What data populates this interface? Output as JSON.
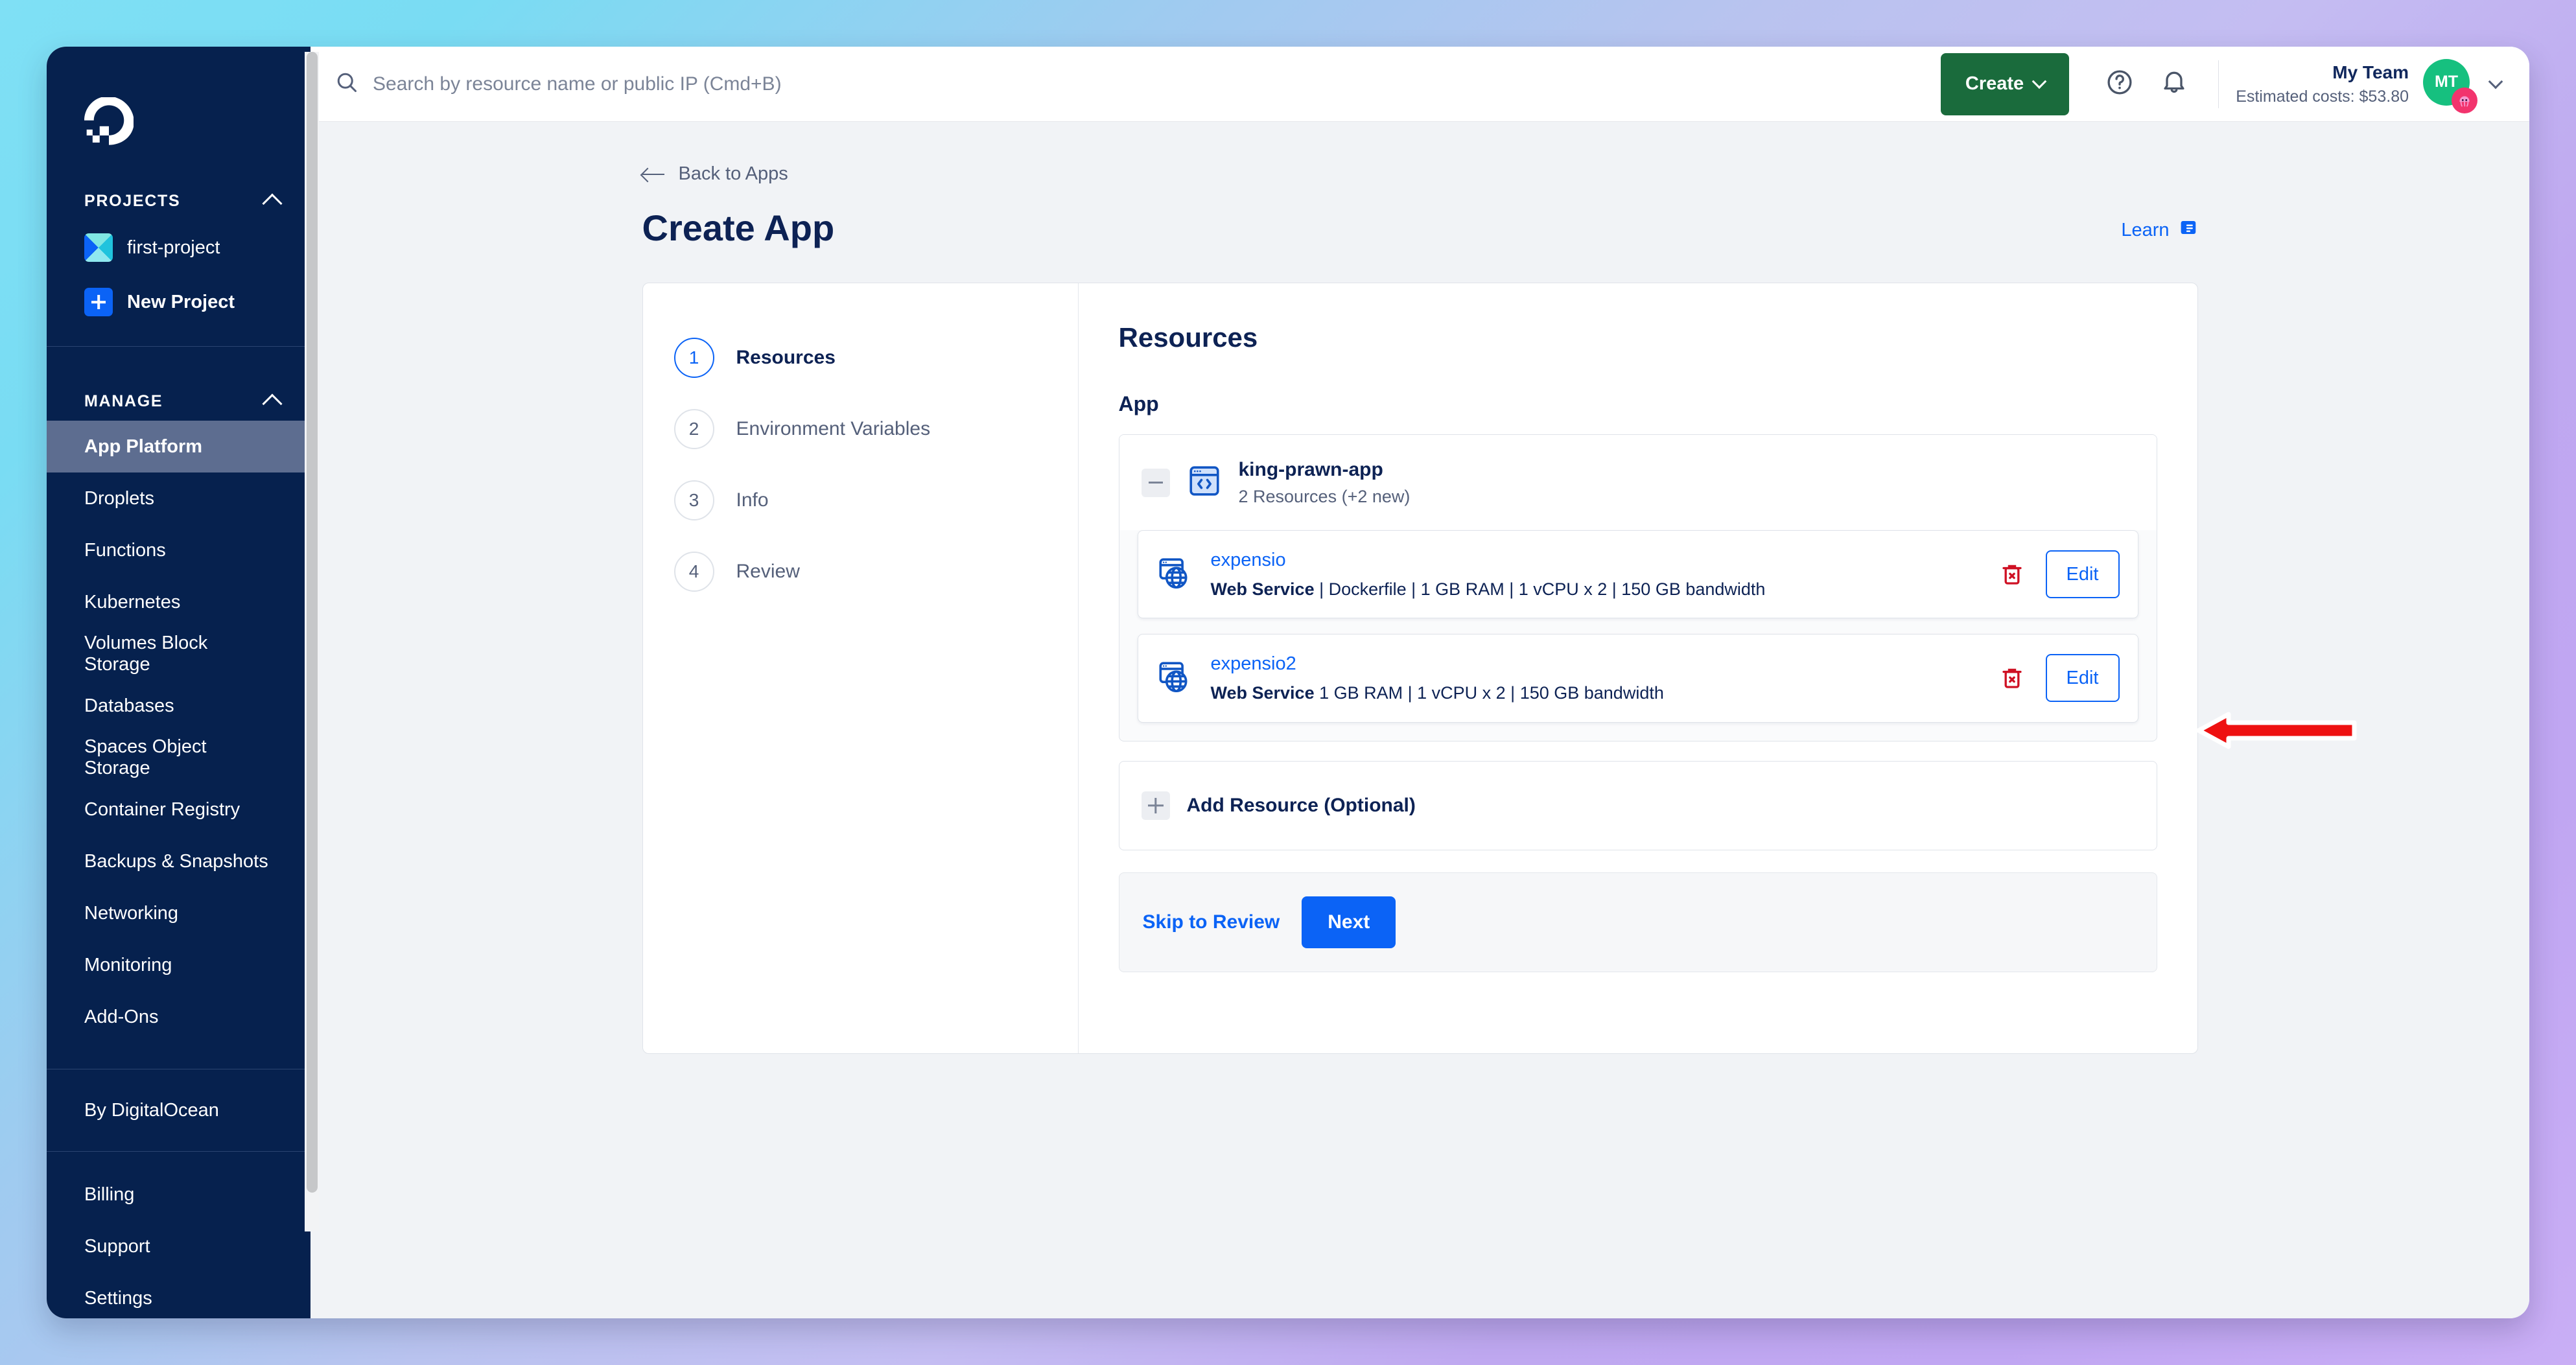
{
  "sidebar": {
    "logo_icon": "digitalocean-logo",
    "projects_section": {
      "label": "PROJECTS",
      "collapse_icon": "chevron-up-icon",
      "items": [
        {
          "label": "first-project",
          "icon": "project-swatch-icon"
        },
        {
          "label": "New Project",
          "icon": "plus-square-icon"
        }
      ]
    },
    "manage_section": {
      "label": "MANAGE",
      "collapse_icon": "chevron-up-icon",
      "items": [
        {
          "label": "App Platform",
          "active": true
        },
        {
          "label": "Droplets",
          "active": false
        },
        {
          "label": "Functions",
          "active": false
        },
        {
          "label": "Kubernetes",
          "active": false
        },
        {
          "label": "Volumes Block Storage",
          "active": false
        },
        {
          "label": "Databases",
          "active": false
        },
        {
          "label": "Spaces Object Storage",
          "active": false
        },
        {
          "label": "Container Registry",
          "active": false
        },
        {
          "label": "Backups & Snapshots",
          "active": false
        },
        {
          "label": "Networking",
          "active": false
        },
        {
          "label": "Monitoring",
          "active": false
        },
        {
          "label": "Add-Ons",
          "active": false
        }
      ]
    },
    "by_digitalocean": "By DigitalOcean",
    "account_items": [
      {
        "label": "Billing"
      },
      {
        "label": "Support"
      },
      {
        "label": "Settings"
      }
    ]
  },
  "topbar": {
    "search_placeholder": "Search by resource name or public IP (Cmd+B)",
    "search_value": "",
    "search_icon": "search-icon",
    "create_label": "Create",
    "create_caret_icon": "chevron-down-icon",
    "help_icon": "question-circle-icon",
    "notifications_icon": "bell-icon",
    "team_name": "My Team",
    "team_cost": "Estimated costs: $53.80",
    "avatar_initials": "MT",
    "avatar_badge_icon": "jellyfish-icon",
    "user_caret_icon": "chevron-down-icon"
  },
  "page": {
    "back_label": "Back to Apps",
    "back_icon": "arrow-left-icon",
    "title": "Create App",
    "learn_label": "Learn",
    "learn_icon": "document-icon"
  },
  "wizard": {
    "steps": [
      {
        "num": "1",
        "label": "Resources",
        "active": true
      },
      {
        "num": "2",
        "label": "Environment Variables",
        "active": false
      },
      {
        "num": "3",
        "label": "Info",
        "active": false
      },
      {
        "num": "4",
        "label": "Review",
        "active": false
      }
    ],
    "panel_title": "Resources",
    "section_label": "App",
    "group": {
      "collapse_icon": "minus-icon",
      "app_icon": "code-window-icon",
      "name": "king-prawn-app",
      "count": "2 Resources (+2 new)"
    },
    "resources": [
      {
        "icon": "web-service-icon",
        "name": "expensio",
        "type": "Web Service",
        "details": " | Dockerfile | 1 GB RAM | 1 vCPU x 2 | 150 GB bandwidth",
        "delete_icon": "trash-icon",
        "edit_label": "Edit"
      },
      {
        "icon": "web-service-icon",
        "name": "expensio2",
        "type": "Web Service",
        "details": " 1 GB RAM | 1 vCPU x 2 | 150 GB bandwidth",
        "delete_icon": "trash-icon",
        "edit_label": "Edit"
      }
    ],
    "add_resource_label": "Add Resource (Optional)",
    "add_resource_icon": "plus-icon",
    "skip_label": "Skip to Review",
    "next_label": "Next"
  },
  "annotation": {
    "arrow_icon": "red-left-arrow-icon",
    "arrow_color": "#ee1111"
  },
  "colors": {
    "sidebar_bg": "#06214e",
    "sidebar_active": "#5d6d90",
    "accent_blue": "#0b63f6",
    "create_green": "#1a6b3c",
    "danger_red": "#cf1124",
    "heading_navy": "#0d2254"
  }
}
